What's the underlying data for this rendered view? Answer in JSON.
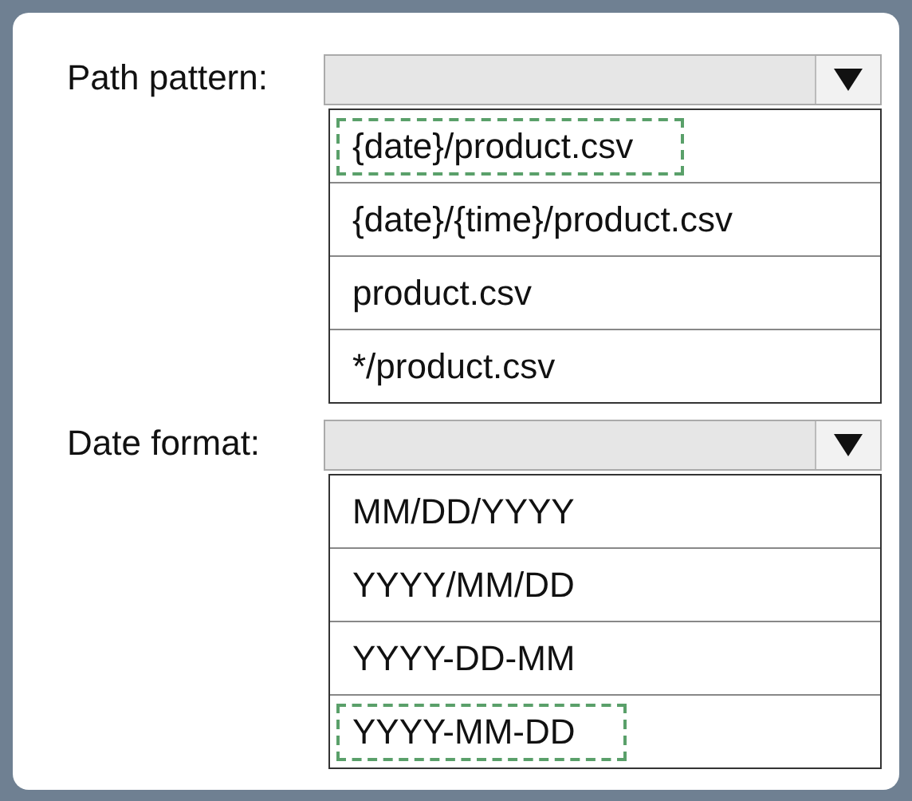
{
  "dropdowns": [
    {
      "label": "Path pattern:",
      "options": [
        {
          "text": "{date}/product.csv",
          "selected": true
        },
        {
          "text": "{date}/{time}/product.csv",
          "selected": false
        },
        {
          "text": "product.csv",
          "selected": false
        },
        {
          "text": "*/product.csv",
          "selected": false
        }
      ]
    },
    {
      "label": "Date format:",
      "options": [
        {
          "text": "MM/DD/YYYY",
          "selected": false
        },
        {
          "text": "YYYY/MM/DD",
          "selected": false
        },
        {
          "text": "YYYY-DD-MM",
          "selected": false
        },
        {
          "text": "YYYY-MM-DD",
          "selected": true
        }
      ]
    }
  ]
}
